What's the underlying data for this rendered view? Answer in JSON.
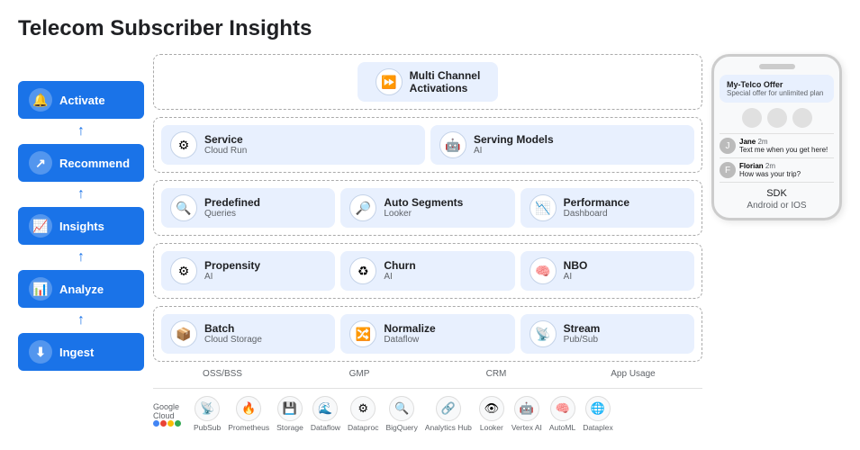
{
  "title": "Telecom Subscriber Insights",
  "sidebar": {
    "items": [
      {
        "label": "Activate",
        "icon": "🔔"
      },
      {
        "label": "Recommend",
        "icon": "↗"
      },
      {
        "label": "Insights",
        "icon": "📈"
      },
      {
        "label": "Analyze",
        "icon": "📊"
      },
      {
        "label": "Ingest",
        "icon": "⬇"
      }
    ]
  },
  "diagram": {
    "top_section": {
      "label": "Multi Channel\nActivations",
      "icon": "⏩"
    },
    "serving_section": {
      "service": {
        "name": "Service",
        "sub": "Cloud Run",
        "icon": "⚙"
      },
      "serving_models": {
        "name": "Serving Models",
        "sub": "AI",
        "icon": "🤖"
      }
    },
    "insights_section": {
      "predefined": {
        "name": "Predefined",
        "sub": "Queries",
        "icon": "🔍"
      },
      "auto_segments": {
        "name": "Auto Segments",
        "sub": "Looker",
        "icon": "🔎"
      },
      "performance": {
        "name": "Performance",
        "sub": "Dashboard",
        "icon": "📉"
      }
    },
    "analyze_section": {
      "propensity": {
        "name": "Propensity",
        "sub": "AI",
        "icon": "⚙"
      },
      "churn": {
        "name": "Churn",
        "sub": "AI",
        "icon": "♻"
      },
      "nbo": {
        "name": "NBO",
        "sub": "AI",
        "icon": "🧠"
      }
    },
    "ingest_section": {
      "batch": {
        "name": "Batch",
        "sub": "Cloud Storage",
        "icon": "📦"
      },
      "normalize": {
        "name": "Normalize",
        "sub": "Dataflow",
        "icon": "🔀"
      },
      "stream": {
        "name": "Stream",
        "sub": "Pub/Sub",
        "icon": "📡"
      }
    },
    "labels": [
      "OSS/BSS",
      "GMP",
      "CRM",
      "App Usage"
    ]
  },
  "phone": {
    "notification": {
      "title": "My-Telco Offer",
      "subtitle": "Special offer for unlimited plan"
    },
    "chats": [
      {
        "name": "Jane",
        "time": "2m",
        "message": "Text me when you get here!"
      },
      {
        "name": "Florian",
        "time": "2m",
        "message": "How was your trip?"
      }
    ],
    "sdk_label": "SDK",
    "platform_label": "Android or IOS"
  },
  "bottom_services": [
    {
      "label": "PubSub",
      "icon": "📡"
    },
    {
      "label": "Prometheus",
      "icon": "🔥"
    },
    {
      "label": "Storage",
      "icon": "💾"
    },
    {
      "label": "Dataflow",
      "icon": "🌊"
    },
    {
      "label": "Dataproc",
      "icon": "⚙"
    },
    {
      "label": "BigQuery",
      "icon": "🔍"
    },
    {
      "label": "Analytics Hub",
      "icon": "🔗"
    },
    {
      "label": "Looker",
      "icon": "👁"
    },
    {
      "label": "Vertex AI",
      "icon": "🤖"
    },
    {
      "label": "AutoML",
      "icon": "🧠"
    },
    {
      "label": "Dataplex",
      "icon": "🌐"
    }
  ]
}
